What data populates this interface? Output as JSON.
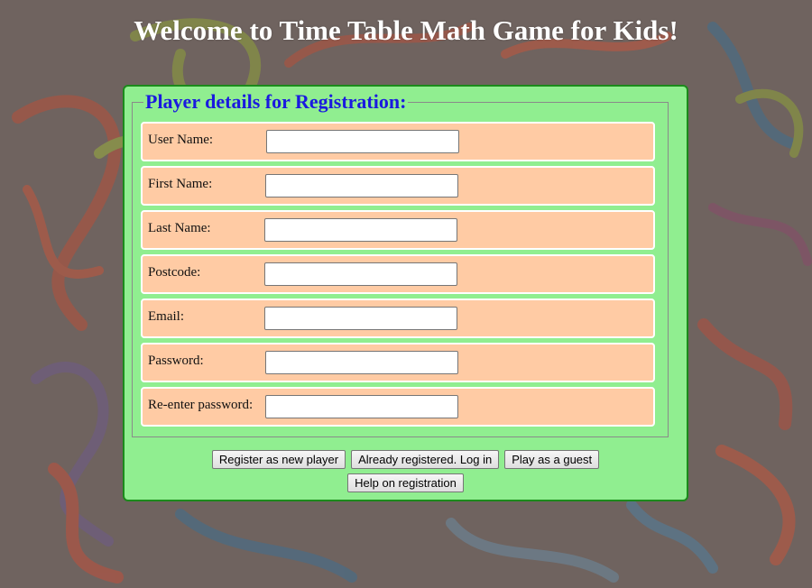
{
  "page": {
    "title": "Welcome to Time Table Math Game for Kids!"
  },
  "form": {
    "legend": "Player details for Registration:",
    "fields": [
      {
        "label": "User Name:",
        "value": ""
      },
      {
        "label": "First Name:",
        "value": ""
      },
      {
        "label": "Last Name:",
        "value": ""
      },
      {
        "label": "Postcode:",
        "value": ""
      },
      {
        "label": "Email:",
        "value": ""
      },
      {
        "label": "Password:",
        "value": ""
      },
      {
        "label": "Re-enter password:",
        "value": ""
      }
    ]
  },
  "buttons": {
    "register": "Register as new player",
    "login": "Already registered. Log in",
    "guest": "Play as a guest",
    "help": "Help on registration"
  },
  "colors": {
    "panel_bg": "#90ee90",
    "panel_border": "#1b8a1b",
    "row_bg": "#ffcba4",
    "legend": "#1a1adf",
    "title": "#ffffff"
  }
}
